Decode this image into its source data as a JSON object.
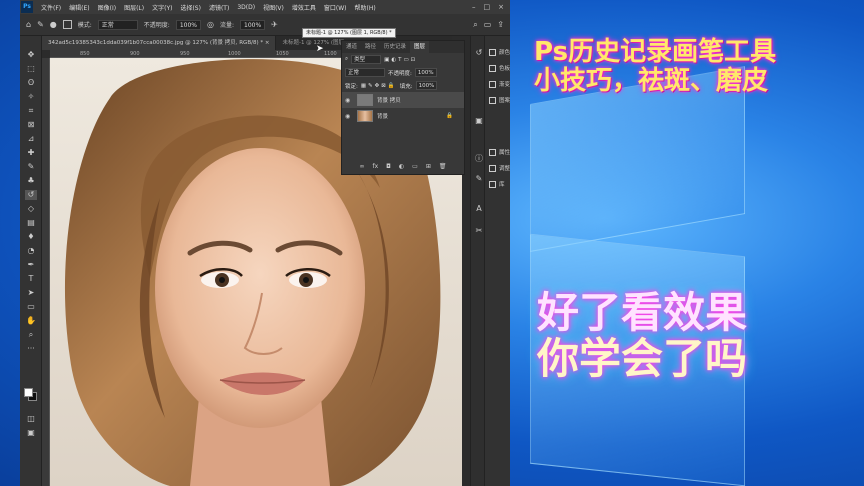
{
  "colors": {
    "desktop_blue": "#1a5fc0",
    "ps_dark": "#2b2b2b",
    "caption_glow": "#ff2fd0",
    "caption_yellow": "#ffe86a"
  },
  "menubar": {
    "logo": "Ps",
    "items": [
      "文件(F)",
      "编辑(E)",
      "图像(I)",
      "图层(L)",
      "文字(Y)",
      "选择(S)",
      "滤镜(T)",
      "3D(D)",
      "视图(V)",
      "增效工具",
      "窗口(W)",
      "帮助(H)"
    ]
  },
  "options": {
    "mode_label": "模式:",
    "mode_value": "正常",
    "opacity_label": "不透明度:",
    "opacity_value": "100%",
    "flow_label": "流量:",
    "flow_value": "100%"
  },
  "tabs": [
    {
      "label": "342ad5c19385343c1dda039f1b07cca00038c.jpg @ 127% (背景 拷贝, RGB/8) *",
      "close": "×"
    },
    {
      "label": "未标题-1 @ 127% (图层 1, RGB/8) *",
      "close": "×"
    }
  ],
  "tooltip": "未标题-1 @ 127% (图层 1, RGB/8) *",
  "ruler": {
    "ticks": [
      "850",
      "900",
      "950",
      "1000",
      "1050",
      "1100",
      "1150",
      "1200"
    ]
  },
  "layers_panel": {
    "tabs": [
      "通道",
      "路径",
      "历史记录",
      "图层"
    ],
    "kind_label": "类型",
    "blend_mode": "正常",
    "opacity_label": "不透明度:",
    "opacity_value": "100%",
    "lock_label": "锁定:",
    "fill_label": "填充:",
    "fill_value": "100%",
    "layers": [
      {
        "name": "背景 拷贝",
        "selected": true
      },
      {
        "name": "背景",
        "selected": false
      }
    ]
  },
  "dock": {
    "items": [
      "颜色",
      "色板",
      "渐变",
      "图案",
      "属性",
      "调整",
      "库"
    ]
  },
  "captions": {
    "title_line1": "Ps历史记录画笔工具",
    "title_line2": "小技巧，祛斑、磨皮",
    "big_line1": "好了看效果",
    "big_line2": "你学会了吗"
  }
}
